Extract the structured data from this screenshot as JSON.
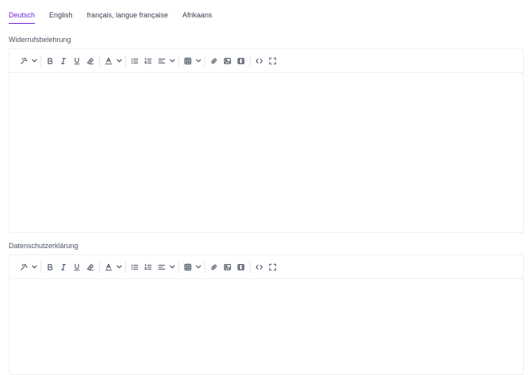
{
  "tabs": [
    {
      "label": "Deutsch",
      "active": true
    },
    {
      "label": "English",
      "active": false
    },
    {
      "label": "français, langue française",
      "active": false
    },
    {
      "label": "Afrikaans",
      "active": false
    }
  ],
  "fields": [
    {
      "label": "Widerrufsbelehrung",
      "content": ""
    },
    {
      "label": "Datenschutzerklärung",
      "content": ""
    }
  ],
  "colors": {
    "accent": "#6d28d9",
    "text": "#374151",
    "border": "#f0f0f3"
  },
  "toolbar_icons": [
    "magic-wand-icon",
    "chevron-down-icon",
    "bold-icon",
    "italic-icon",
    "underline-icon",
    "eraser-icon",
    "font-color-icon",
    "chevron-down-icon",
    "bullet-list-icon",
    "numbered-list-icon",
    "align-icon",
    "chevron-down-icon",
    "table-icon",
    "chevron-down-icon",
    "link-icon",
    "image-icon",
    "video-icon",
    "code-view-icon",
    "fullscreen-icon"
  ]
}
